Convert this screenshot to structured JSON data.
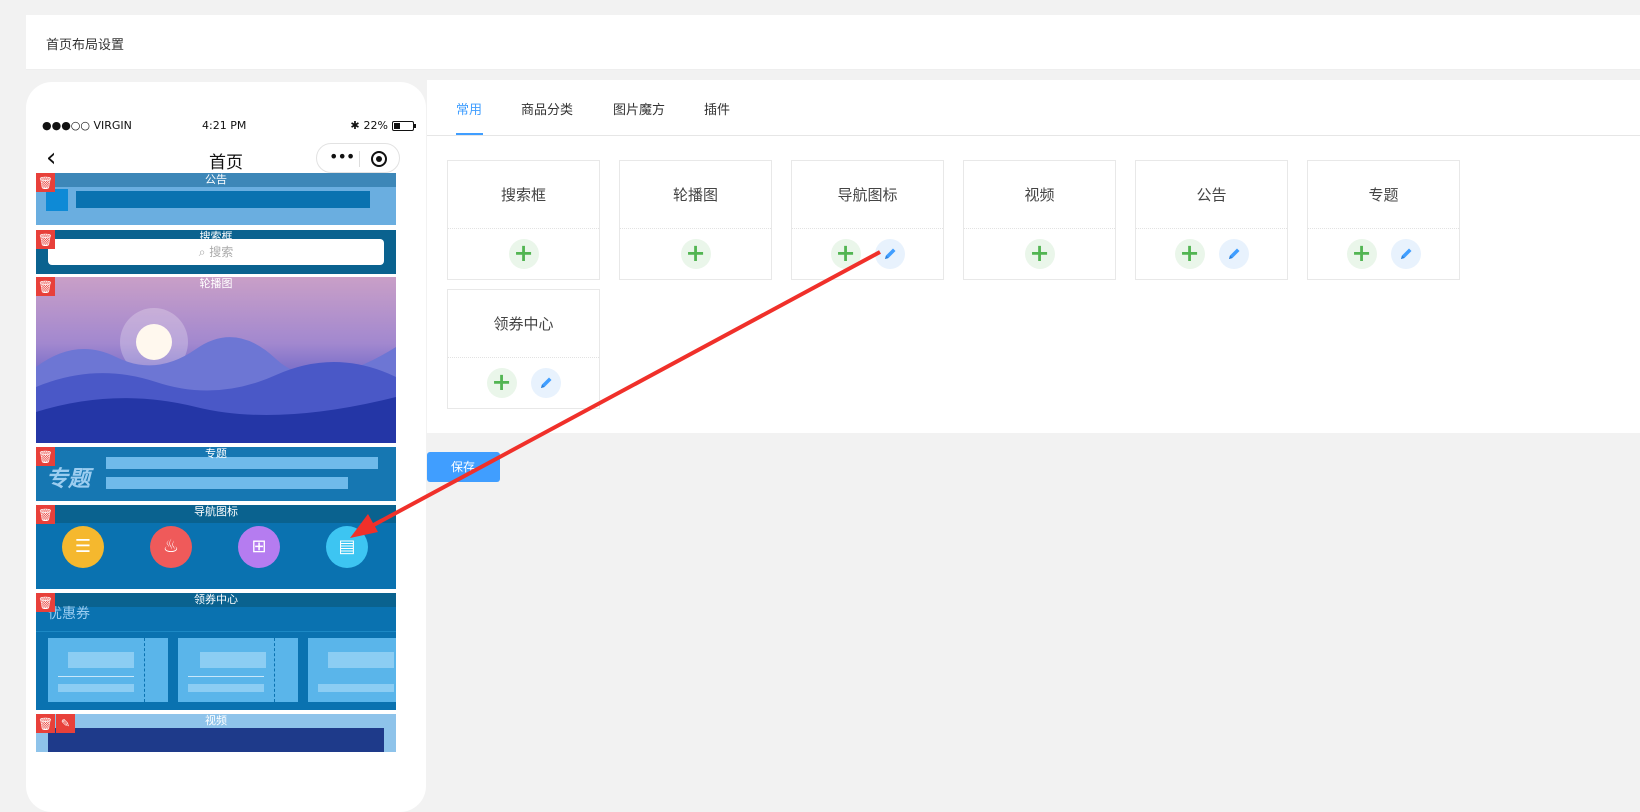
{
  "page": {
    "title": "首页布局设置"
  },
  "phone": {
    "status": {
      "carrier": "●●●○○ VIRGIN",
      "time": "4:21 PM",
      "battery": "22%"
    },
    "nav_title": "首页",
    "modules": {
      "notice": "公告",
      "search": "搜索框",
      "search_placeholder": "搜索",
      "carousel": "轮播图",
      "topic": "专题",
      "topic_badge": "专题",
      "nav_icons": "导航图标",
      "coupon": "领券中心",
      "coupon_badge": "优惠券",
      "video": "视频"
    }
  },
  "tabs": [
    "常用",
    "商品分类",
    "图片魔方",
    "插件"
  ],
  "cards": [
    {
      "name": "搜索框",
      "editable": false
    },
    {
      "name": "轮播图",
      "editable": false
    },
    {
      "name": "导航图标",
      "editable": true
    },
    {
      "name": "视频",
      "editable": false
    },
    {
      "name": "公告",
      "editable": true
    },
    {
      "name": "专题",
      "editable": true
    },
    {
      "name": "领券中心",
      "editable": true
    }
  ],
  "save_label": "保存",
  "colors": {
    "accent": "#409eff",
    "danger": "#e8403a",
    "add": "#52b552"
  }
}
